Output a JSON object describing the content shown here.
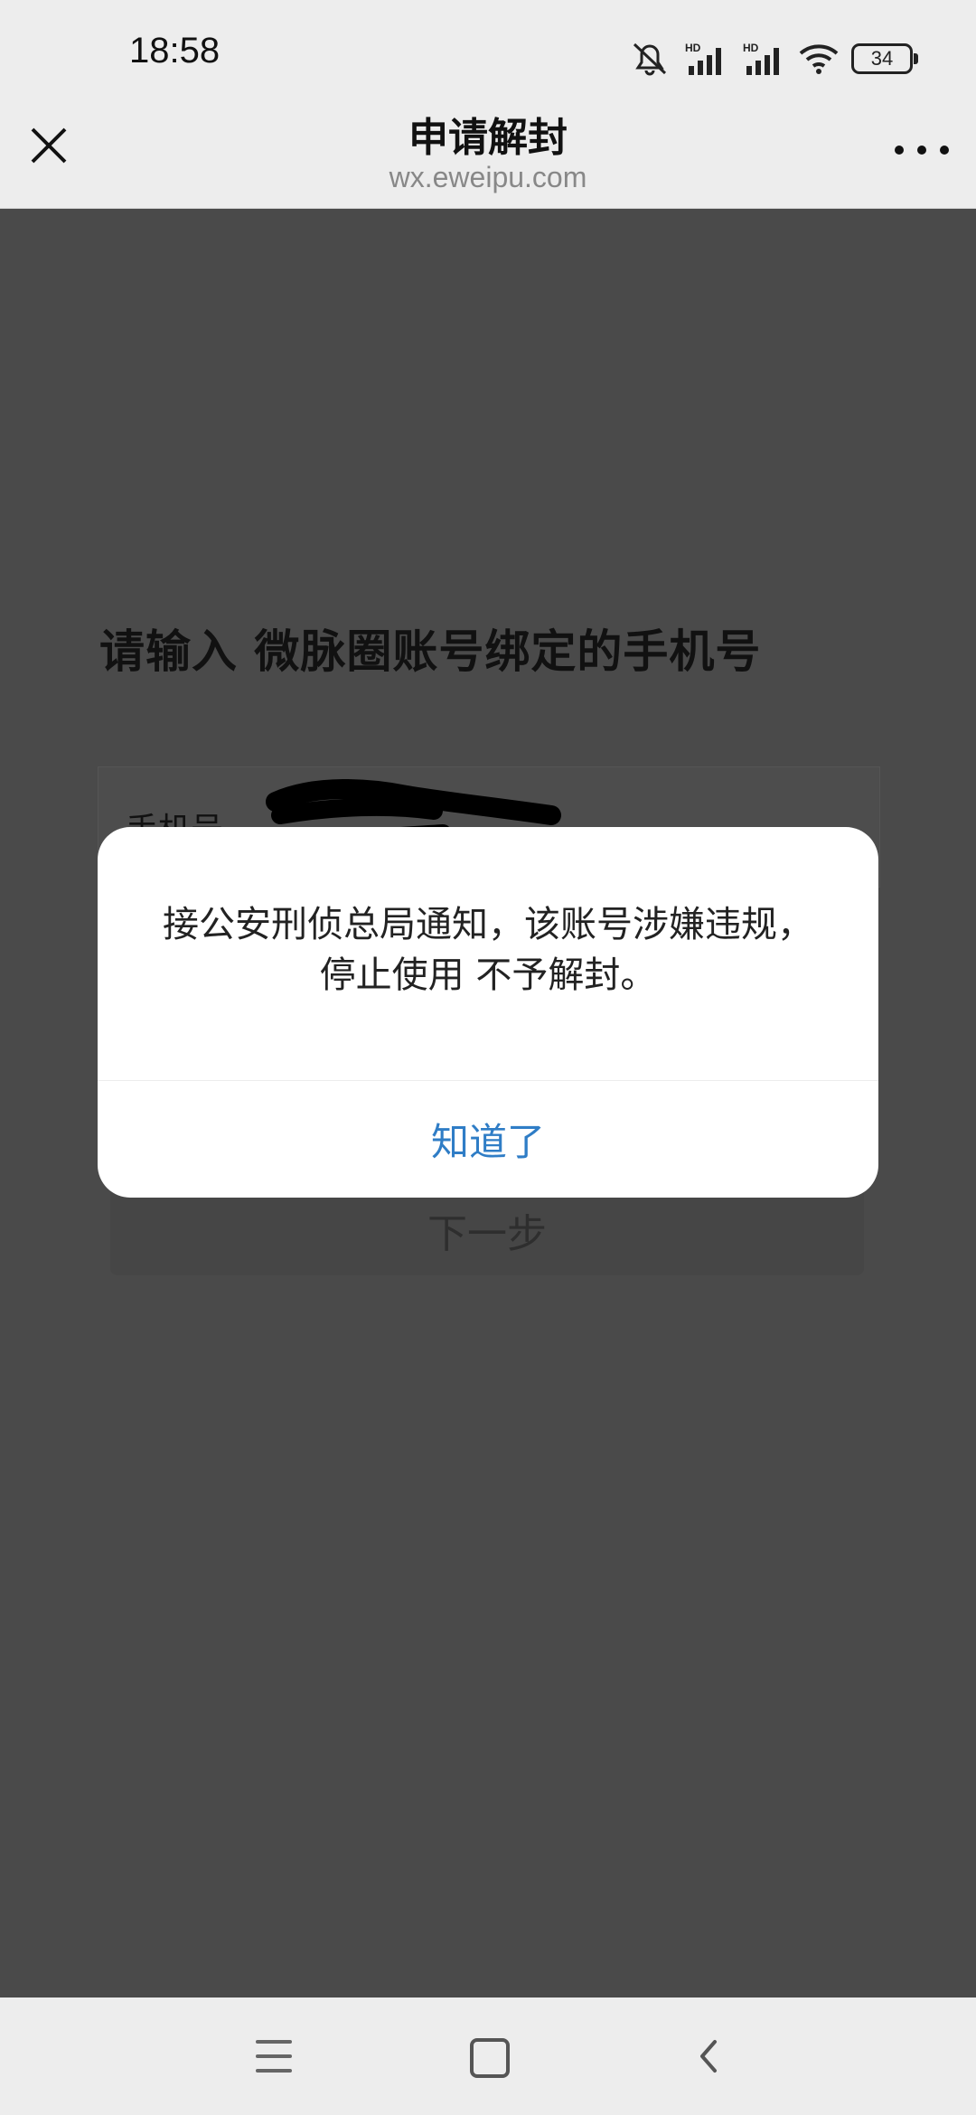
{
  "status_bar": {
    "time": "18:58",
    "battery": "34",
    "icons": [
      "mute-icon",
      "hd-signal-icon",
      "hd-signal-icon",
      "wifi-icon",
      "battery-icon"
    ]
  },
  "nav": {
    "title": "申请解封",
    "subtitle": "wx.eweipu.com"
  },
  "page": {
    "heading": "请输入 微脉圈账号绑定的手机号",
    "phone_label": "手机号",
    "next_label": "下一步"
  },
  "dialog": {
    "message": "接公安刑侦总局通知，该账号涉嫌违规，停止使用 不予解封。",
    "ok_label": "知道了",
    "ok_color": "#2f7dc6"
  },
  "system_nav": {
    "icons": [
      "menu-icon",
      "home-icon",
      "back-icon"
    ]
  }
}
